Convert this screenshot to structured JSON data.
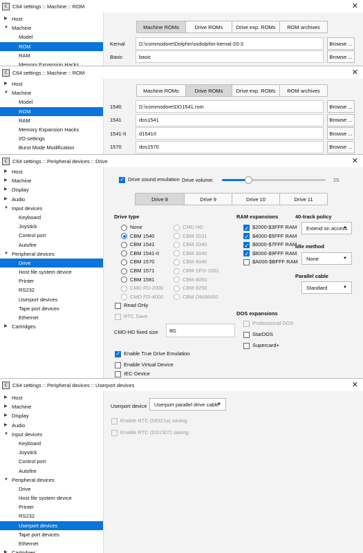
{
  "win1": {
    "title": "C64 settings :: Machine :: ROM",
    "tree": [
      {
        "label": "Host",
        "arrow": "▶",
        "lvl": 0
      },
      {
        "label": "Machine",
        "arrow": "▼",
        "lvl": 0
      },
      {
        "label": "Model",
        "lvl": 1
      },
      {
        "label": "ROM",
        "lvl": 1,
        "sel": true
      },
      {
        "label": "RAM",
        "lvl": 1
      },
      {
        "label": "Memory Expansion Hacks",
        "lvl": 1
      }
    ],
    "tabs": [
      "Machine ROMs",
      "Drive ROMs",
      "Drive exp. ROMs",
      "ROM archives"
    ],
    "active_tab": 0,
    "rows": [
      {
        "label": "Kernal",
        "value": "D:\\commodore\\Dolphin\\sxdolphin-kernal-20-3",
        "button": "Browse ..."
      },
      {
        "label": "Basic",
        "value": "basic",
        "button": "Browse ..."
      }
    ]
  },
  "win2": {
    "title": "C64 settings :: Machine :: ROM",
    "tree": [
      {
        "label": "Host",
        "arrow": "▶",
        "lvl": 0
      },
      {
        "label": "Machine",
        "arrow": "▼",
        "lvl": 0
      },
      {
        "label": "Model",
        "lvl": 1
      },
      {
        "label": "ROM",
        "lvl": 1,
        "sel": true
      },
      {
        "label": "RAM",
        "lvl": 1
      },
      {
        "label": "Memory Expansion Hacks",
        "lvl": 1
      },
      {
        "label": "I/O settings",
        "lvl": 1
      },
      {
        "label": "Burst Mode Modification",
        "lvl": 1
      }
    ],
    "tabs": [
      "Machine ROMs",
      "Drive ROMs",
      "Drive exp. ROMs",
      "ROM archives"
    ],
    "active_tab": 1,
    "rows": [
      {
        "label": "1540",
        "value": "D:\\commodore\\DD1541.rom",
        "button": "Browse ..."
      },
      {
        "label": "1541",
        "value": "dos1541",
        "button": "Browse ..."
      },
      {
        "label": "1541-II",
        "value": "d1541II",
        "button": "Browse ..."
      },
      {
        "label": "1570",
        "value": "dos1570",
        "button": "Browse ..."
      }
    ]
  },
  "win3": {
    "title": "C64 settings :: Peripheral devices :: Drive",
    "tree": [
      {
        "label": "Host",
        "arrow": "▶",
        "lvl": 0
      },
      {
        "label": "Machine",
        "arrow": "▶",
        "lvl": 0
      },
      {
        "label": "Display",
        "arrow": "▶",
        "lvl": 0
      },
      {
        "label": "Audio",
        "arrow": "▶",
        "lvl": 0
      },
      {
        "label": "Input devices",
        "arrow": "▼",
        "lvl": 0
      },
      {
        "label": "Keyboard",
        "lvl": 1
      },
      {
        "label": "Joystick",
        "lvl": 1
      },
      {
        "label": "Control port",
        "lvl": 1
      },
      {
        "label": "Autofire",
        "lvl": 1
      },
      {
        "label": "Peripheral devices",
        "arrow": "▼",
        "lvl": 0
      },
      {
        "label": "Drive",
        "lvl": 1,
        "sel": true
      },
      {
        "label": "Host file system device",
        "lvl": 1
      },
      {
        "label": "Printer",
        "lvl": 1
      },
      {
        "label": "RS232",
        "lvl": 1
      },
      {
        "label": "Userport devices",
        "lvl": 1
      },
      {
        "label": "Tape port devices",
        "lvl": 1
      },
      {
        "label": "Ethernet",
        "lvl": 1
      },
      {
        "label": "Cartridges",
        "arrow": "▶",
        "lvl": 0
      }
    ],
    "sound_label": "Drive sound emulation",
    "volume_label": "Drive volume:",
    "volume_value": "25",
    "tabs": [
      "Drive 8",
      "Drive 9",
      "Drive 10",
      "Drive 11"
    ],
    "active_tab": 0,
    "drive_type_title": "Drive type",
    "drive_types_col1": [
      {
        "label": "None",
        "on": false,
        "dis": false
      },
      {
        "label": "CBM 1540",
        "on": true,
        "dis": false
      },
      {
        "label": "CBM 1541",
        "on": false,
        "dis": false
      },
      {
        "label": "CBM 1541-II",
        "on": false,
        "dis": false
      },
      {
        "label": "CBM 1570",
        "on": false,
        "dis": false
      },
      {
        "label": "CBM 1571",
        "on": false,
        "dis": false
      },
      {
        "label": "CBM 1581",
        "on": false,
        "dis": false
      },
      {
        "label": "CMD FD-2000",
        "on": false,
        "dis": true
      },
      {
        "label": "CMD FD-4000",
        "on": false,
        "dis": true
      }
    ],
    "drive_types_col2": [
      {
        "label": "CMD HD",
        "dis": true
      },
      {
        "label": "CBM 2031",
        "dis": true
      },
      {
        "label": "CBM 2040",
        "dis": true
      },
      {
        "label": "CBM 3040",
        "dis": true
      },
      {
        "label": "CBM 4040",
        "dis": true
      },
      {
        "label": "CBM SFD-1001",
        "dis": true
      },
      {
        "label": "CBM 8050",
        "dis": true
      },
      {
        "label": "CBM 8250",
        "dis": true
      },
      {
        "label": "CBM D9090/60",
        "dis": true
      }
    ],
    "read_only": "Read Only",
    "rtc_save": "RTC Save",
    "cmdhd_label": "CMD-HD fixed size",
    "cmdhd_value": "8G",
    "true_drive": "Enable True Drive Emulation",
    "virtual_device": "Enable Virtual Device",
    "iec_device": "IEC-Device",
    "ram_title": "RAM expansions",
    "ram": [
      {
        "label": "$2000-$3FFF RAM",
        "on": true
      },
      {
        "label": "$4000-$5FFF RAM",
        "on": true
      },
      {
        "label": "$6000-$7FFF RAM",
        "on": true
      },
      {
        "label": "$8000-$9FFF RAM",
        "on": true
      },
      {
        "label": "$A000-$BFFF RAM",
        "on": false
      }
    ],
    "track_title": "40-track policy",
    "track_value": "Extend on access",
    "idle_title": "Idle method",
    "idle_value": "None",
    "parallel_title": "Parallel cable",
    "parallel_value": "Standard",
    "dos_title": "DOS expansions",
    "dos": [
      {
        "label": "Professional DOS",
        "dis": true
      },
      {
        "label": "StarDOS",
        "dis": false
      },
      {
        "label": "Supercard+",
        "dis": false
      }
    ]
  },
  "win4": {
    "title": "C64 settings :: Peripheral devices :: Userport devices",
    "tree": [
      {
        "label": "Host",
        "arrow": "▶",
        "lvl": 0
      },
      {
        "label": "Machine",
        "arrow": "▶",
        "lvl": 0
      },
      {
        "label": "Display",
        "arrow": "▶",
        "lvl": 0
      },
      {
        "label": "Audio",
        "arrow": "▶",
        "lvl": 0
      },
      {
        "label": "Input devices",
        "arrow": "▼",
        "lvl": 0
      },
      {
        "label": "Keyboard",
        "lvl": 1
      },
      {
        "label": "Joystick",
        "lvl": 1
      },
      {
        "label": "Control port",
        "lvl": 1
      },
      {
        "label": "Autofire",
        "lvl": 1
      },
      {
        "label": "Peripheral devices",
        "arrow": "▼",
        "lvl": 0
      },
      {
        "label": "Drive",
        "lvl": 1
      },
      {
        "label": "Host file system device",
        "lvl": 1
      },
      {
        "label": "Printer",
        "lvl": 1
      },
      {
        "label": "RS232",
        "lvl": 1
      },
      {
        "label": "Userport devices",
        "lvl": 1,
        "sel": true
      },
      {
        "label": "Tape port devices",
        "lvl": 1
      },
      {
        "label": "Ethernet",
        "lvl": 1
      },
      {
        "label": "Cartridges",
        "arrow": "▶",
        "lvl": 0
      }
    ],
    "device_label": "Userport device",
    "device_value": "Userport parallel drive cable",
    "rtc1": "Enable RTC (58321a) saving",
    "rtc2": "Enable RTC (DS1307) saving"
  },
  "icons": {
    "app": "c64-app-icon",
    "close": "close-icon"
  }
}
